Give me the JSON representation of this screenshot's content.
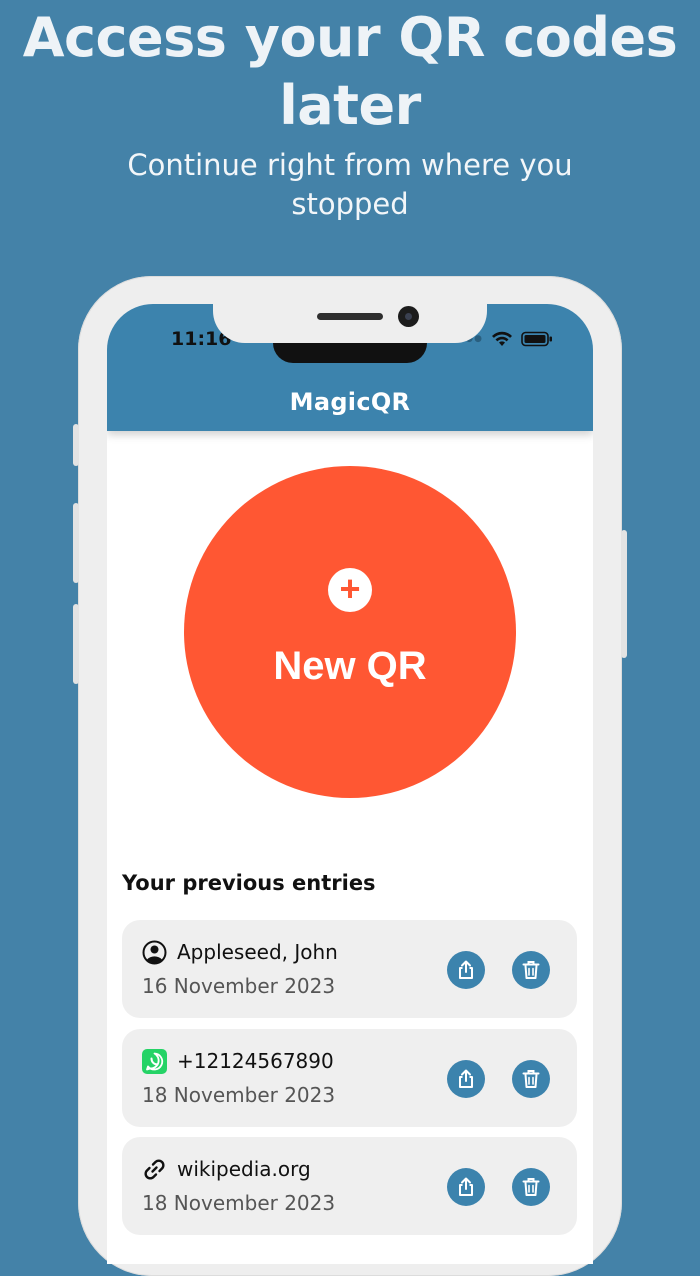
{
  "promo": {
    "headline": "Access your QR codes later",
    "subtitle": "Continue right from where you stopped"
  },
  "status_bar": {
    "time": "11:16"
  },
  "app": {
    "title": "MagicQR"
  },
  "new_qr": {
    "label": "New QR"
  },
  "entries_section": {
    "title": "Your previous entries",
    "items": [
      {
        "type_icon": "contact-icon",
        "name": "Appleseed, John",
        "date": "16 November 2023"
      },
      {
        "type_icon": "whatsapp-icon",
        "name": "+12124567890",
        "date": "18 November 2023"
      },
      {
        "type_icon": "link-icon",
        "name": "wikipedia.org",
        "date": "18 November 2023"
      }
    ]
  },
  "colors": {
    "background": "#4482a8",
    "app_bar": "#3c83ad",
    "new_qr_button": "#ff5733",
    "entry_card": "#efefef",
    "action_button": "#3c83ad",
    "whatsapp": "#25d366"
  }
}
